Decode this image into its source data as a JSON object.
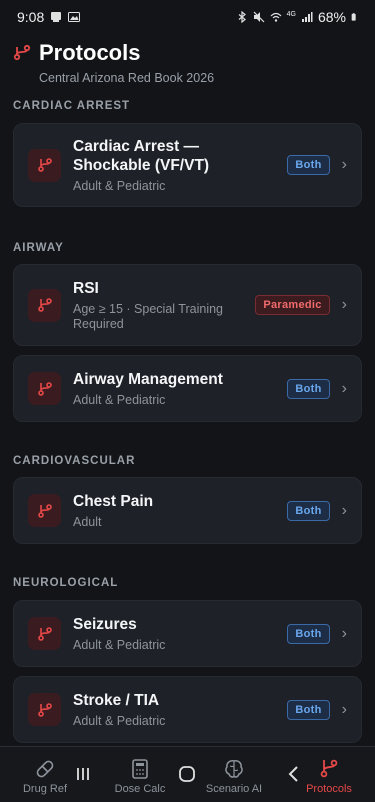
{
  "status_bar": {
    "time": "9:08",
    "battery": "68%",
    "network": "4G"
  },
  "header": {
    "title": "Protocols",
    "subtitle": "Central Arizona Red Book 2026"
  },
  "sections": {
    "cardiac": {
      "label": "CARDIAC ARREST"
    },
    "airway": {
      "label": "AIRWAY"
    },
    "cardio": {
      "label": "CARDIOVASCULAR"
    },
    "neuro": {
      "label": "NEUROLOGICAL"
    }
  },
  "cards": {
    "c1": {
      "title": "Cardiac Arrest — Shockable (VF/VT)",
      "sub": "Adult & Pediatric",
      "badge": "Both"
    },
    "c2": {
      "title": "RSI",
      "sub": "Age ≥ 15 · Special Training Required",
      "badge": "Paramedic"
    },
    "c3": {
      "title": "Airway Management",
      "sub": "Adult & Pediatric",
      "badge": "Both"
    },
    "c4": {
      "title": "Chest Pain",
      "sub": "Adult",
      "badge": "Both"
    },
    "c5": {
      "title": "Seizures",
      "sub": "Adult & Pediatric",
      "badge": "Both"
    },
    "c6": {
      "title": "Stroke / TIA",
      "sub": "Adult & Pediatric",
      "badge": "Both"
    }
  },
  "nav": {
    "drug": "Drug Ref",
    "dose": "Dose Calc",
    "scenario": "Scenario AI",
    "protocols": "Protocols"
  },
  "colors": {
    "accent": "#e54848",
    "background": "#121418",
    "card": "#1e2127",
    "badge_both": "#6aa7ee",
    "badge_paramedic": "#f06b6b"
  },
  "icons": {
    "protocol": "branch-icon",
    "drug": "pill-icon",
    "dose": "calculator-icon",
    "scenario": "brain-icon"
  }
}
